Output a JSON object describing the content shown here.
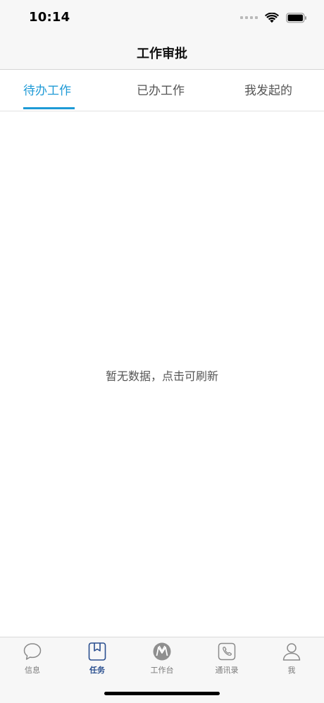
{
  "status_bar": {
    "time": "10:14"
  },
  "header": {
    "title": "工作审批"
  },
  "tabs": [
    {
      "label": "待办工作",
      "active": true
    },
    {
      "label": "已办工作",
      "active": false
    },
    {
      "label": "我发起的",
      "active": false
    }
  ],
  "main": {
    "empty_message": "暂无数据，点击可刷新"
  },
  "tabbar": {
    "items": [
      {
        "label": "信息",
        "icon": "chat-bubble-icon",
        "active": false
      },
      {
        "label": "任务",
        "icon": "bookmark-icon",
        "active": true
      },
      {
        "label": "工作台",
        "icon": "workbench-logo-icon",
        "active": false
      },
      {
        "label": "通讯录",
        "icon": "phone-icon",
        "active": false
      },
      {
        "label": "我",
        "icon": "person-icon",
        "active": false
      }
    ]
  },
  "colors": {
    "accent": "#1e9ad6",
    "tabbar_active": "#2a4f8f",
    "text_gray": "#555555"
  }
}
